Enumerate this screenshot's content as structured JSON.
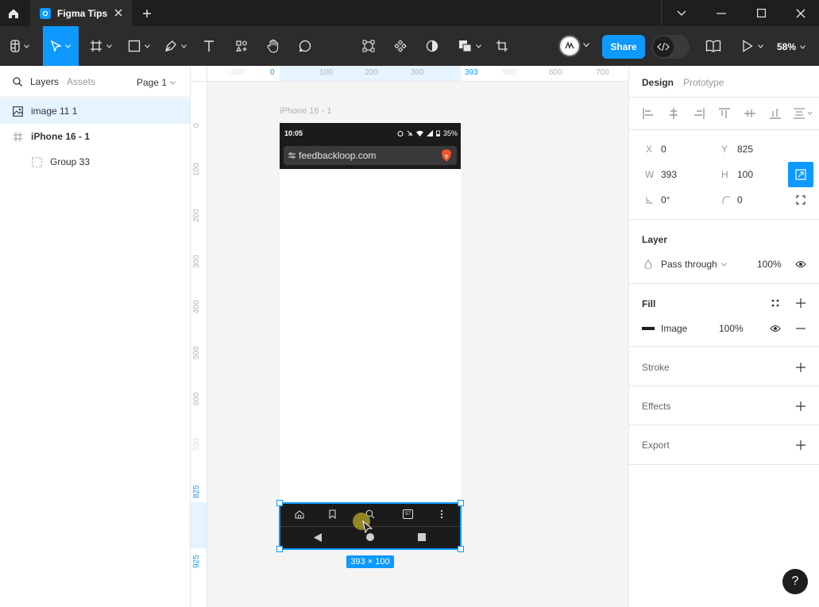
{
  "titlebar": {
    "tab_label": "Figma Tips"
  },
  "toolbar": {
    "share_label": "Share",
    "zoom": "58%"
  },
  "left_panel": {
    "tabs": [
      "Layers",
      "Assets"
    ],
    "page": "Page 1",
    "layers": [
      {
        "name": "image 11 1",
        "icon": "image-icon"
      },
      {
        "name": "iPhone 16 - 1",
        "icon": "frame-icon"
      },
      {
        "name": "Group 33",
        "icon": "group-icon"
      }
    ]
  },
  "rulers": {
    "top": [
      "-100",
      "0",
      "100",
      "200",
      "300",
      "393",
      "500",
      "600",
      "700"
    ],
    "left": [
      "0",
      "100",
      "200",
      "300",
      "400",
      "500",
      "600",
      "700",
      "825",
      "925"
    ]
  },
  "canvas": {
    "frame_label": "iPhone 16 - 1",
    "status_time": "10:05",
    "battery": "35%",
    "url": "feedbackloop.com",
    "tab_count": "57",
    "size_badge": "393 × 100"
  },
  "right_panel": {
    "tabs": [
      "Design",
      "Prototype"
    ],
    "x_label": "X",
    "x_value": "0",
    "y_label": "Y",
    "y_value": "825",
    "w_label": "W",
    "w_value": "393",
    "h_label": "H",
    "h_value": "100",
    "rotation": "0°",
    "radius": "0",
    "layer_title": "Layer",
    "blend_mode": "Pass through",
    "layer_opacity": "100%",
    "fill_title": "Fill",
    "fill_type": "Image",
    "fill_opacity": "100%",
    "stroke_title": "Stroke",
    "effects_title": "Effects",
    "export_title": "Export"
  },
  "help_label": "?",
  "colors": {
    "accent": "#0d99ff",
    "dark": "#2c2c2c",
    "titlebar": "#1e1e1e"
  }
}
